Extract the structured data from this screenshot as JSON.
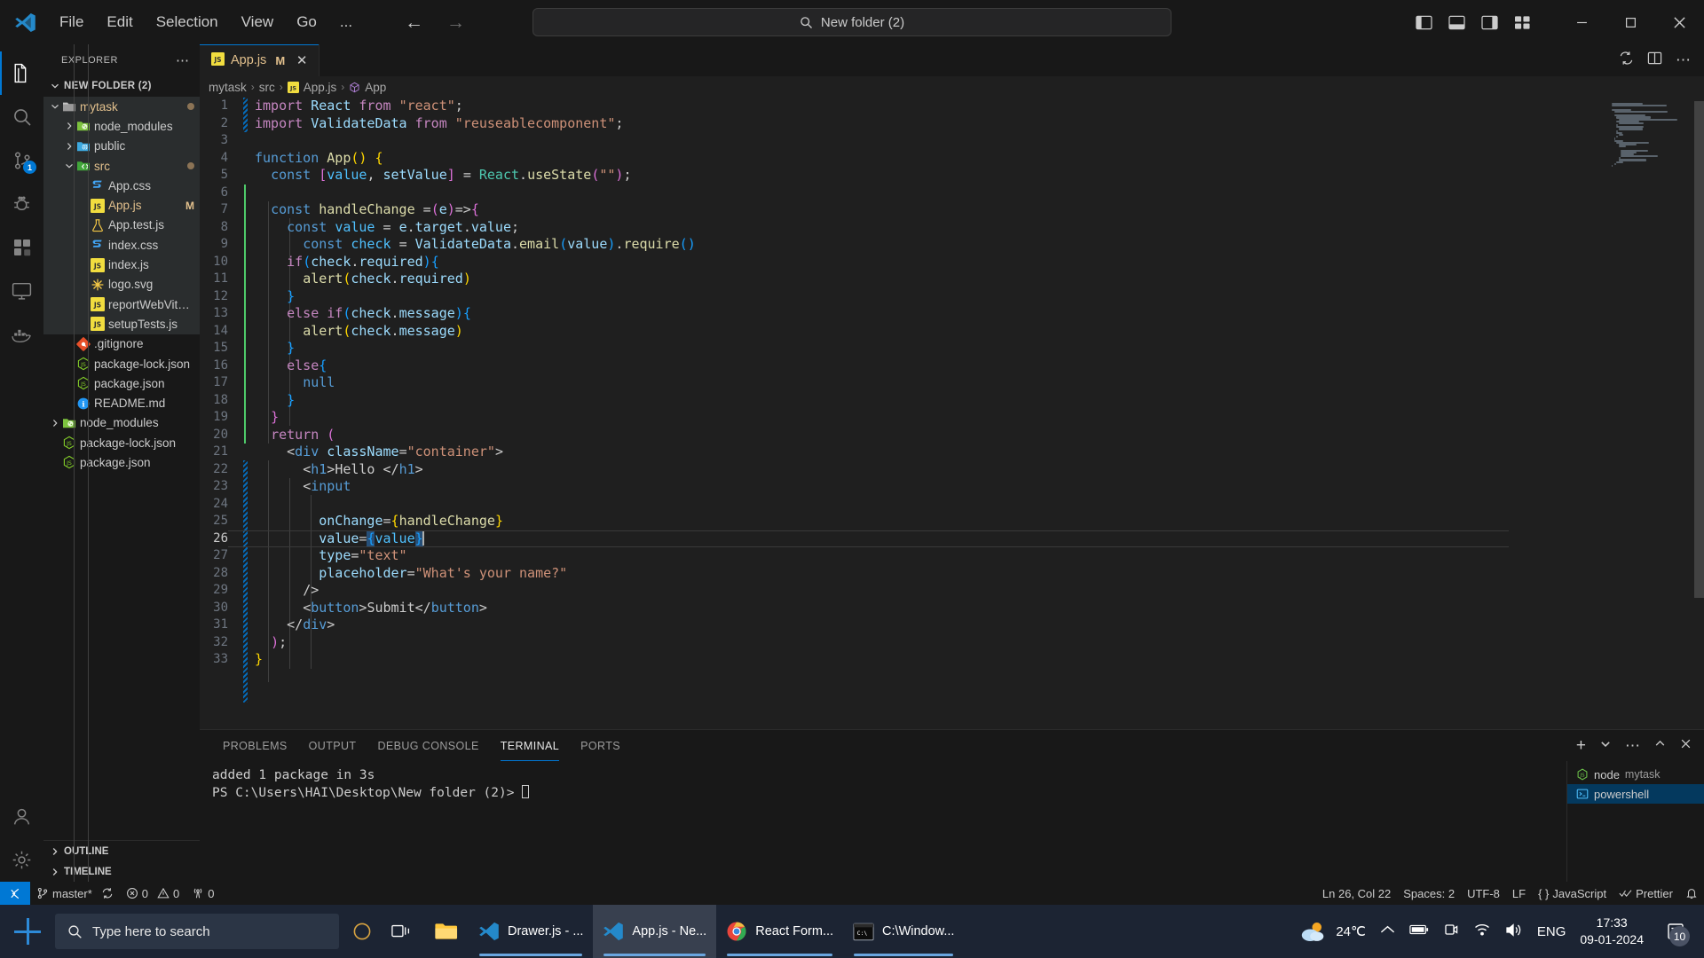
{
  "titlebar": {
    "menu": [
      "File",
      "Edit",
      "Selection",
      "View",
      "Go",
      "..."
    ],
    "search_text": "New folder (2)",
    "back_icon": "arrow-left-icon",
    "forward_icon": "arrow-right-icon"
  },
  "activitybar": {
    "items": [
      {
        "name": "explorer",
        "icon": "files-icon"
      },
      {
        "name": "search",
        "icon": "search-icon"
      },
      {
        "name": "source-control",
        "icon": "source-control-icon",
        "badge": "1"
      },
      {
        "name": "run-and-debug",
        "icon": "debug-icon"
      },
      {
        "name": "extensions",
        "icon": "extensions-icon"
      },
      {
        "name": "remote-explorer",
        "icon": "remote-icon"
      },
      {
        "name": "docker",
        "icon": "docker-icon"
      },
      {
        "name": "accounts",
        "icon": "account-icon"
      },
      {
        "name": "settings",
        "icon": "gear-icon"
      }
    ]
  },
  "sidebar": {
    "title": "EXPLORER",
    "root_label": "NEW FOLDER (2)",
    "tree": [
      {
        "label": "mytask",
        "icon": "folder-icon",
        "depth": 1,
        "type": "folder",
        "expanded": true,
        "dirty": true
      },
      {
        "label": "node_modules",
        "icon": "folder-node-icon",
        "depth": 2,
        "type": "folder",
        "expanded": false
      },
      {
        "label": "public",
        "icon": "folder-public-icon",
        "depth": 2,
        "type": "folder",
        "expanded": false
      },
      {
        "label": "src",
        "icon": "folder-src-icon",
        "depth": 2,
        "type": "folder",
        "expanded": true,
        "dirty": true
      },
      {
        "label": "App.css",
        "icon": "css-icon",
        "depth": 3,
        "type": "file"
      },
      {
        "label": "App.js",
        "icon": "js-icon",
        "depth": 3,
        "type": "file",
        "badge": "M",
        "modified": true
      },
      {
        "label": "App.test.js",
        "icon": "test-icon",
        "depth": 3,
        "type": "file"
      },
      {
        "label": "index.css",
        "icon": "css-icon",
        "depth": 3,
        "type": "file"
      },
      {
        "label": "index.js",
        "icon": "js-icon",
        "depth": 3,
        "type": "file"
      },
      {
        "label": "logo.svg",
        "icon": "svg-icon",
        "depth": 3,
        "type": "file"
      },
      {
        "label": "reportWebVital...",
        "icon": "js-icon",
        "depth": 3,
        "type": "file"
      },
      {
        "label": "setupTests.js",
        "icon": "js-icon",
        "depth": 3,
        "type": "file"
      },
      {
        "label": ".gitignore",
        "icon": "git-icon",
        "depth": 2,
        "type": "file"
      },
      {
        "label": "package-lock.json",
        "icon": "nodejs-icon",
        "depth": 2,
        "type": "file"
      },
      {
        "label": "package.json",
        "icon": "nodejs-icon",
        "depth": 2,
        "type": "file"
      },
      {
        "label": "README.md",
        "icon": "info-icon",
        "depth": 2,
        "type": "file"
      },
      {
        "label": "node_modules",
        "icon": "folder-node-icon",
        "depth": 1,
        "type": "folder",
        "expanded": false
      },
      {
        "label": "package-lock.json",
        "icon": "nodejs-icon",
        "depth": 1,
        "type": "file"
      },
      {
        "label": "package.json",
        "icon": "nodejs-icon",
        "depth": 1,
        "type": "file"
      }
    ],
    "sections": [
      "OUTLINE",
      "TIMELINE"
    ]
  },
  "editor": {
    "tab": {
      "label": "App.js",
      "modified_badge": "M",
      "close": "✕",
      "icon": "js-icon"
    },
    "breadcrumb": [
      "mytask",
      "src",
      "App.js",
      "App"
    ],
    "lines": [
      {
        "n": 1,
        "html": "<span class=\"k\">import</span> <span class=\"va\">React</span> <span class=\"k\">from</span> <span class=\"st\">\"react\"</span><span class=\"pn\">;</span>"
      },
      {
        "n": 2,
        "html": "<span class=\"k\">import</span> <span class=\"va\">ValidateData</span> <span class=\"k\">from</span> <span class=\"st\">\"reuseablecomponent\"</span><span class=\"pn\">;</span>"
      },
      {
        "n": 3,
        "html": ""
      },
      {
        "n": 4,
        "html": "<span class=\"kb\">function</span> <span class=\"fn\">App</span><span class=\"b1\">(</span><span class=\"b1\">)</span> <span class=\"b1\">{</span>"
      },
      {
        "n": 5,
        "html": "  <span class=\"kb\">const</span> <span class=\"b2\">[</span><span class=\"cn\">value</span><span class=\"pn\">,</span> <span class=\"va\">setValue</span><span class=\"b2\">]</span> <span class=\"pn\">=</span> <span class=\"cl\">React</span><span class=\"pn\">.</span><span class=\"fn\">useState</span><span class=\"b2\">(</span><span class=\"st\">\"\"</span><span class=\"b2\">)</span><span class=\"pn\">;</span>"
      },
      {
        "n": 6,
        "html": ""
      },
      {
        "n": 7,
        "html": "  <span class=\"kb\">const</span> <span class=\"fn\">handleChange</span> <span class=\"pn\">=</span><span class=\"b2\">(</span><span class=\"va\">e</span><span class=\"b2\">)</span><span class=\"pn\">=&gt;</span><span class=\"b2\">{</span>"
      },
      {
        "n": 8,
        "html": "    <span class=\"kb\">const</span> <span class=\"cn\">value</span> <span class=\"pn\">=</span> <span class=\"va\">e</span><span class=\"pn\">.</span><span class=\"va\">target</span><span class=\"pn\">.</span><span class=\"va\">value</span><span class=\"pn\">;</span>"
      },
      {
        "n": 9,
        "html": "      <span class=\"kb\">const</span> <span class=\"cn\">check</span> <span class=\"pn\">=</span> <span class=\"va\">ValidateData</span><span class=\"pn\">.</span><span class=\"fn\">email</span><span class=\"b3\">(</span><span class=\"va\">value</span><span class=\"b3\">)</span><span class=\"pn\">.</span><span class=\"fn\">require</span><span class=\"b3\">(</span><span class=\"b3\">)</span>"
      },
      {
        "n": 10,
        "html": "    <span class=\"k\">if</span><span class=\"b3\">(</span><span class=\"va\">check</span><span class=\"pn\">.</span><span class=\"va\">required</span><span class=\"b3\">)</span><span class=\"b3\">{</span>"
      },
      {
        "n": 11,
        "html": "      <span class=\"fn\">alert</span><span class=\"b1\">(</span><span class=\"va\">check</span><span class=\"pn\">.</span><span class=\"va\">required</span><span class=\"b1\">)</span>"
      },
      {
        "n": 12,
        "html": "    <span class=\"b3\">}</span>"
      },
      {
        "n": 13,
        "html": "    <span class=\"k\">else if</span><span class=\"b3\">(</span><span class=\"va\">check</span><span class=\"pn\">.</span><span class=\"va\">message</span><span class=\"b3\">)</span><span class=\"b3\">{</span>"
      },
      {
        "n": 14,
        "html": "      <span class=\"fn\">alert</span><span class=\"b1\">(</span><span class=\"va\">check</span><span class=\"pn\">.</span><span class=\"va\">message</span><span class=\"b1\">)</span>"
      },
      {
        "n": 15,
        "html": "    <span class=\"b3\">}</span>"
      },
      {
        "n": 16,
        "html": "    <span class=\"k\">else</span><span class=\"b3\">{</span>"
      },
      {
        "n": 17,
        "html": "      <span class=\"kb\">null</span>"
      },
      {
        "n": 18,
        "html": "    <span class=\"b3\">}</span>"
      },
      {
        "n": 19,
        "html": "  <span class=\"b2\">}</span>"
      },
      {
        "n": 20,
        "html": "  <span class=\"k\">return</span> <span class=\"b2\">(</span>"
      },
      {
        "n": 21,
        "html": "    <span class=\"pn\">&lt;</span><span class=\"tg\">div</span> <span class=\"at\">className</span><span class=\"pn\">=</span><span class=\"st\">\"container\"</span><span class=\"pn\">&gt;</span>"
      },
      {
        "n": 22,
        "html": "      <span class=\"pn\">&lt;</span><span class=\"tg\">h1</span><span class=\"pn\">&gt;</span><span class=\"pn\">Hello </span><span class=\"pn\">&lt;/</span><span class=\"tg\">h1</span><span class=\"pn\">&gt;</span>"
      },
      {
        "n": 23,
        "html": "      <span class=\"pn\">&lt;</span><span class=\"tg\">input</span>"
      },
      {
        "n": 24,
        "html": ""
      },
      {
        "n": 25,
        "html": "        <span class=\"at\">onChange</span><span class=\"pn\">=</span><span class=\"b1\">{</span><span class=\"fn\">handleChange</span><span class=\"b1\">}</span>"
      },
      {
        "n": 26,
        "html": "        <span class=\"at\">value</span><span class=\"pn\">=</span><span class=\"selbox b3\">{</span><span class=\"cn\">value</span><span class=\"selbox b3\">}</span><span class=\"caret\"></span>",
        "current": true
      },
      {
        "n": 27,
        "html": "        <span class=\"at\">type</span><span class=\"pn\">=</span><span class=\"st\">\"text\"</span>"
      },
      {
        "n": 28,
        "html": "        <span class=\"at\">placeholder</span><span class=\"pn\">=</span><span class=\"st\">\"What's your name?\"</span>"
      },
      {
        "n": 29,
        "html": "      <span class=\"pn\">/&gt;</span>"
      },
      {
        "n": 30,
        "html": "      <span class=\"pn\">&lt;</span><span class=\"tg\">button</span><span class=\"pn\">&gt;</span><span class=\"pn\">Submit</span><span class=\"pn\">&lt;/</span><span class=\"tg\">button</span><span class=\"pn\">&gt;</span>"
      },
      {
        "n": 31,
        "html": "    <span class=\"pn\">&lt;/</span><span class=\"tg\">div</span><span class=\"pn\">&gt;</span>"
      },
      {
        "n": 32,
        "html": "  <span class=\"b2\">)</span><span class=\"pn\">;</span>"
      },
      {
        "n": 33,
        "html": "<span class=\"b1\">}</span>"
      }
    ]
  },
  "panel": {
    "tabs": [
      "PROBLEMS",
      "OUTPUT",
      "DEBUG CONSOLE",
      "TERMINAL",
      "PORTS"
    ],
    "active_tab": "TERMINAL",
    "terminal_lines": [
      "added 1 package in 3s",
      "PS C:\\Users\\HAI\\Desktop\\New folder (2)> "
    ],
    "terminal_list": [
      {
        "label": "node",
        "sub": "mytask",
        "icon": "nodejs-icon",
        "active": false
      },
      {
        "label": "powershell",
        "sub": "",
        "icon": "terminal-icon",
        "active": true
      }
    ],
    "actions": [
      "new-terminal-icon",
      "chevron-down-icon",
      "ellipsis-icon",
      "maximize-panel-icon",
      "close-panel-icon"
    ]
  },
  "statusbar": {
    "remote_icon": "remote-indicator-icon",
    "branch": "master*",
    "sync_icon": "sync-icon",
    "errors": "0",
    "warnings": "0",
    "radio_count": "0",
    "cursor_position": "Ln 26, Col 22",
    "spaces": "Spaces: 2",
    "encoding": "UTF-8",
    "eol": "LF",
    "language": "JavaScript",
    "formatter": "Prettier",
    "bell_icon": "bell-icon"
  },
  "taskbar": {
    "search_placeholder": "Type here to search",
    "items": [
      {
        "label": "Drawer.js - ...",
        "icon": "vscode-icon",
        "active": false
      },
      {
        "label": "App.js - Ne...",
        "icon": "vscode-icon",
        "active": true
      },
      {
        "label": "React Form...",
        "icon": "chrome-icon",
        "active": false
      },
      {
        "label": "C:\\Window...",
        "icon": "terminal-icon",
        "active": false
      }
    ],
    "weather_temp": "24℃",
    "language": "ENG",
    "time": "17:33",
    "date": "09-01-2024",
    "notification_count": "10"
  },
  "colors": {
    "accent": "#0078d4",
    "modified": "#e2c08d",
    "string": "#ce9178",
    "keyword": "#c586c0",
    "function": "#dcdcaa",
    "variable": "#9cdcfe",
    "taskbar_bg": "#1c2433"
  }
}
